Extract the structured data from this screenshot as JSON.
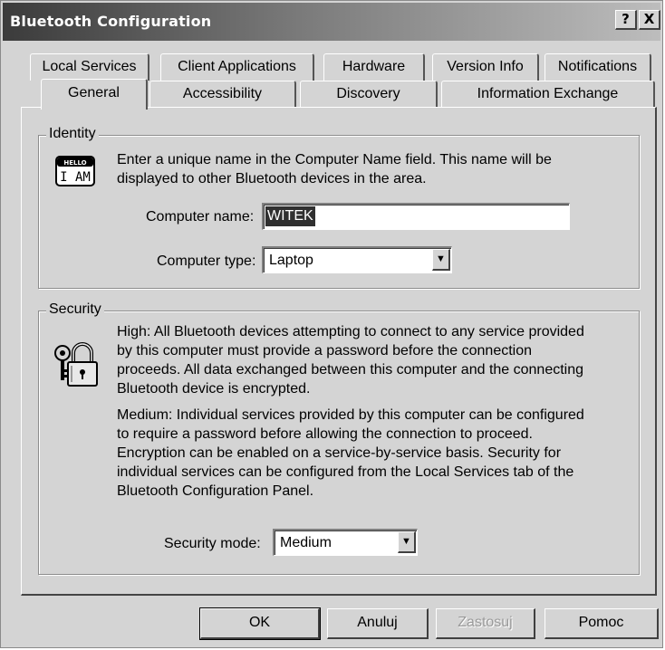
{
  "window": {
    "title": "Bluetooth Configuration",
    "help_btn": "?",
    "close_btn": "X"
  },
  "tabs": {
    "row_back": [
      "Local Services",
      "Client Applications",
      "Hardware",
      "Version Info",
      "Notifications"
    ],
    "row_front": [
      "General",
      "Accessibility",
      "Discovery",
      "Information Exchange"
    ],
    "active": "General"
  },
  "identity": {
    "legend": "Identity",
    "icon_badge_top": "HELLO",
    "icon_badge_text": "I AM",
    "description_line1": "Enter a unique name in the Computer Name field. This name will be",
    "description_line2": "displayed to other Bluetooth devices in the area.",
    "computer_name_label": "Computer name:",
    "computer_name_value": "WITEK",
    "computer_type_label": "Computer type:",
    "computer_type_value": "Laptop"
  },
  "security": {
    "legend": "Security",
    "high_lines": [
      "High: All Bluetooth devices attempting to connect to any service provided",
      "by this computer must provide a password before the connection",
      "proceeds. All data exchanged between this computer and the connecting",
      "Bluetooth device is encrypted."
    ],
    "medium_lines": [
      "Medium: Individual services provided by this computer can be configured",
      "to require a password before allowing the connection to proceed.",
      "Encryption can be enabled on a service-by-service basis. Security for",
      "individual services can be configured from the Local Services tab of the",
      "Bluetooth Configuration Panel."
    ],
    "mode_label": "Security mode:",
    "mode_value": "Medium"
  },
  "buttons": {
    "ok": "OK",
    "cancel": "Anuluj",
    "apply": "Zastosuj",
    "help": "Pomoc"
  }
}
